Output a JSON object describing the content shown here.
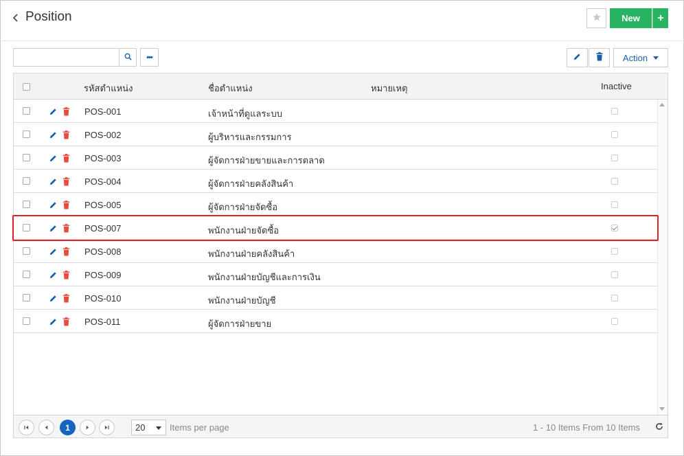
{
  "header": {
    "title": "Position",
    "new_label": "New",
    "plus_label": "+"
  },
  "toolbar": {
    "search_value": "",
    "search_placeholder": "",
    "more_label": "•••",
    "action_label": "Action"
  },
  "grid": {
    "columns": {
      "code": "รหัสตำแหน่ง",
      "name": "ชื่อตำแหน่ง",
      "note": "หมายเหตุ",
      "inactive": "Inactive"
    },
    "rows": [
      {
        "code": "POS-001",
        "name": "เจ้าหน้าที่ดูแลระบบ",
        "note": "",
        "inactive": false
      },
      {
        "code": "POS-002",
        "name": "ผู้บริหารและกรรมการ",
        "note": "",
        "inactive": false
      },
      {
        "code": "POS-003",
        "name": "ผู้จัดการฝ่ายขายและการตลาด",
        "note": "",
        "inactive": false
      },
      {
        "code": "POS-004",
        "name": "ผู้จัดการฝ่ายคลังสินค้า",
        "note": "",
        "inactive": false
      },
      {
        "code": "POS-005",
        "name": "ผู้จัดการฝ่ายจัดซื้อ",
        "note": "",
        "inactive": false
      },
      {
        "code": "POS-007",
        "name": "พนักงานฝ่ายจัดซื้อ",
        "note": "",
        "inactive": true
      },
      {
        "code": "POS-008",
        "name": "พนักงานฝ่ายคลังสินค้า",
        "note": "",
        "inactive": false
      },
      {
        "code": "POS-009",
        "name": "พนักงานฝ่ายบัญชีและการเงิน",
        "note": "",
        "inactive": false
      },
      {
        "code": "POS-010",
        "name": "พนักงานฝ่ายบัญชี",
        "note": "",
        "inactive": false
      },
      {
        "code": "POS-011",
        "name": "ผู้จัดการฝ่ายขาย",
        "note": "",
        "inactive": false
      }
    ]
  },
  "pager": {
    "current_page": "1",
    "page_size": "20",
    "per_page_label": "Items per page",
    "info": "1 - 10 Items From 10 Items"
  },
  "colors": {
    "accent_green": "#28b463",
    "primary_blue": "#1565c0",
    "delete_red": "#e84c3d",
    "highlight_red": "#e3202a"
  },
  "icons": {
    "back": "chevron-left-icon",
    "favorite": "star-icon",
    "search": "search-icon",
    "more": "ellipsis-icon",
    "edit": "pencil-icon",
    "delete": "trash-icon",
    "refresh": "refresh-icon"
  }
}
